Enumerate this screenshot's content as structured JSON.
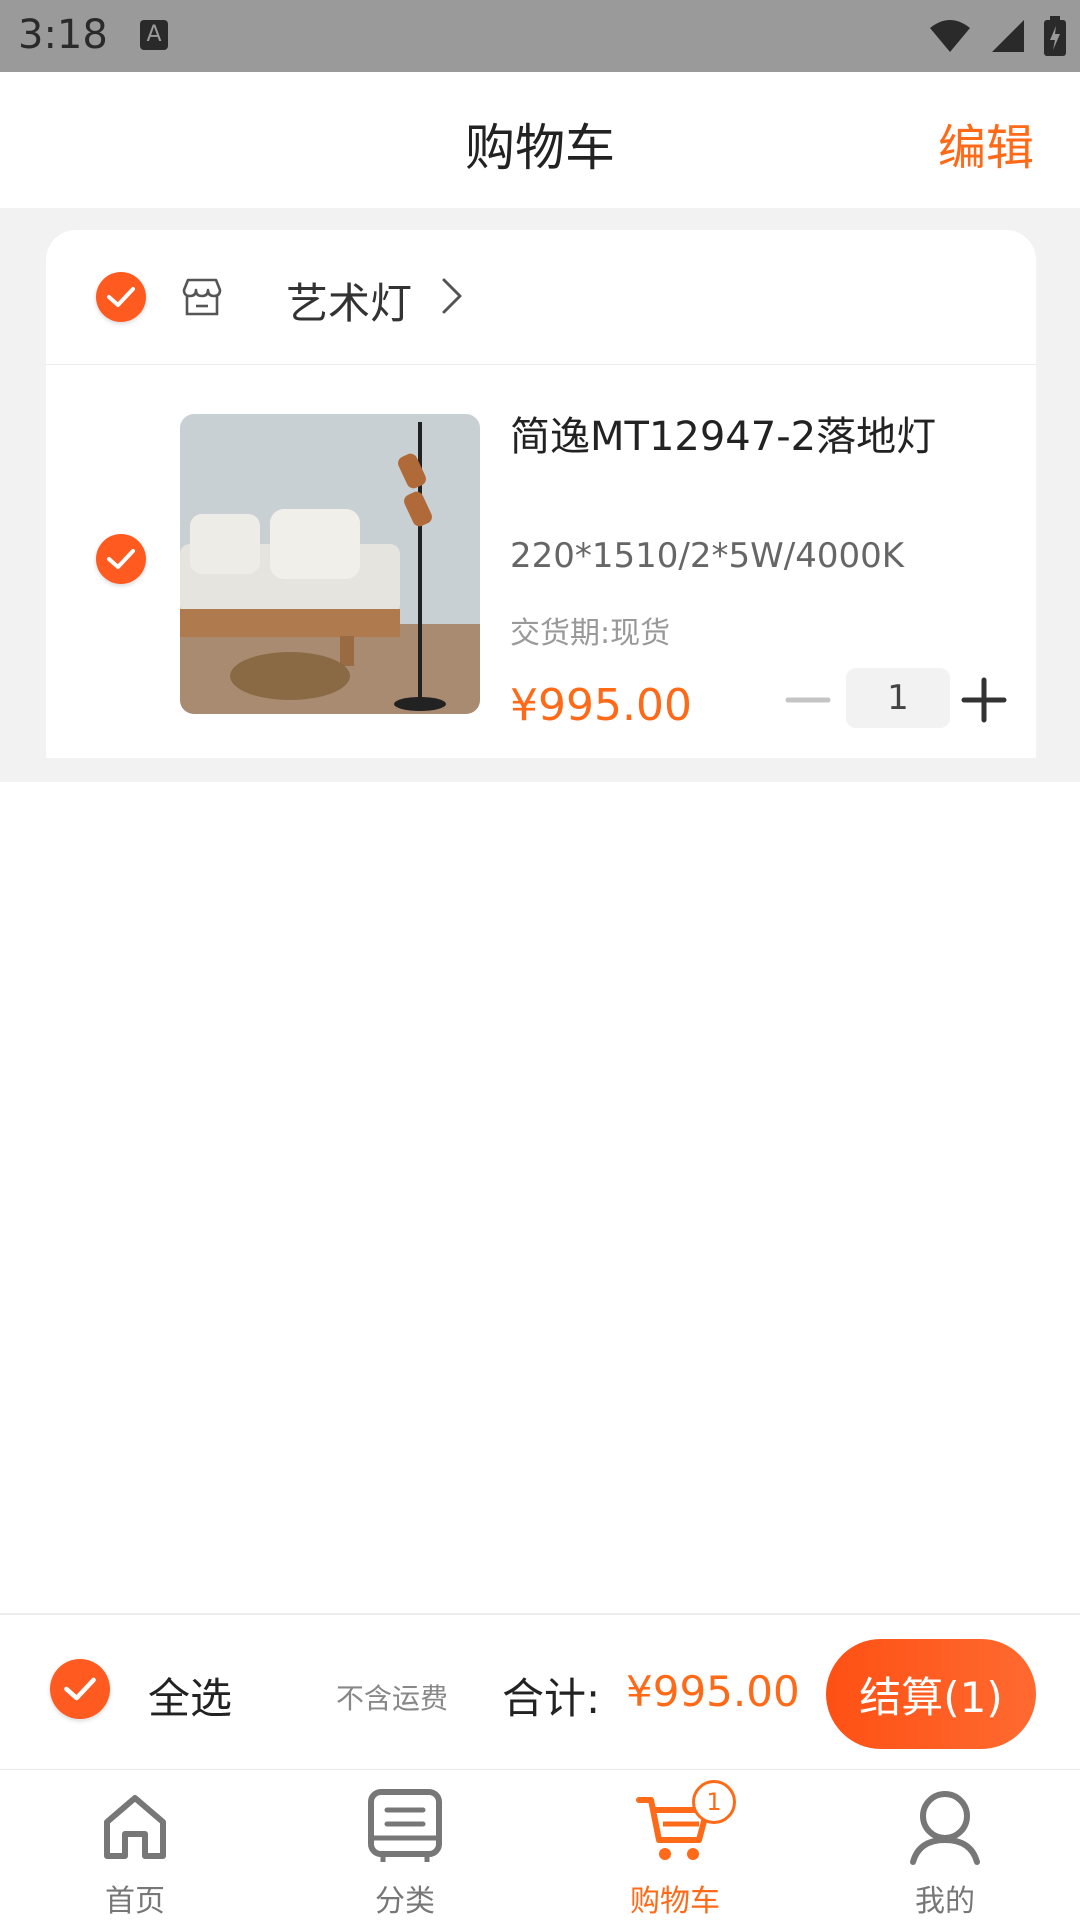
{
  "status_bar": {
    "time": "3:18",
    "notification_icon": "A"
  },
  "header": {
    "title": "购物车",
    "edit_label": "编辑"
  },
  "store": {
    "name": "艺术灯"
  },
  "item": {
    "title": "简逸MT12947-2落地灯",
    "spec": "220*1510/2*5W/4000K",
    "delivery": "交货期:现货",
    "price": "¥995.00",
    "quantity": "1"
  },
  "summary": {
    "select_all_label": "全选",
    "freight_note": "不含运费",
    "total_label": "合计:",
    "total_value": "¥995.00",
    "checkout_label": "结算(1)"
  },
  "tabbar": {
    "tabs": [
      {
        "label": "首页",
        "icon": "home-icon"
      },
      {
        "label": "分类",
        "icon": "category-icon"
      },
      {
        "label": "购物车",
        "icon": "cart-icon",
        "badge": "1"
      },
      {
        "label": "我的",
        "icon": "profile-icon"
      }
    ]
  },
  "colors": {
    "accent": "#ff6a18",
    "check": "#ff5a1f",
    "background": "#f2f2f2"
  }
}
